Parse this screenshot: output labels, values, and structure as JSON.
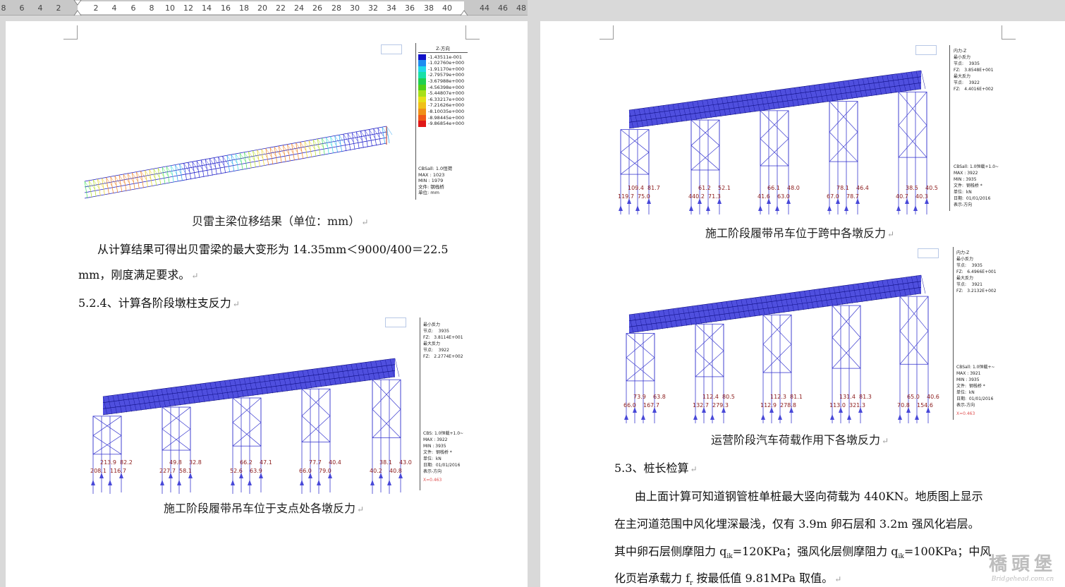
{
  "ruler": {
    "ticks": [
      "8",
      "6",
      "4",
      "2",
      "2",
      "4",
      "6",
      "8",
      "10",
      "12",
      "14",
      "16",
      "18",
      "20",
      "22",
      "24",
      "26",
      "28",
      "30",
      "32",
      "34",
      "36",
      "38",
      "40",
      "44",
      "46",
      "48"
    ]
  },
  "page1": {
    "fig1": {
      "legend_title": "Z-方向",
      "values": [
        "-1.43511e-001",
        "-1.02760e+000",
        "-1.91170e+000",
        "-2.79579e+000",
        "-3.67988e+000",
        "-4.56398e+000",
        "-5.44807e+000",
        "-6.33217e+000",
        "-7.21626e+000",
        "-8.10035e+000",
        "-8.98445e+000",
        "-9.86854e+000"
      ],
      "colors": [
        "#1212c8",
        "#1e8cf0",
        "#20d8e8",
        "#18e0a8",
        "#20d050",
        "#50d018",
        "#a8e018",
        "#e6e018",
        "#f0c018",
        "#f09018",
        "#f05818",
        "#e01818"
      ],
      "info": [
        "CBSall: 1.0恒荷",
        "MAX : 1023",
        "MIN : 1979",
        "文件:  钢栈桥",
        "单位:  mm"
      ],
      "caption": "贝雷主梁位移结果（单位：mm）"
    },
    "paragraph": {
      "line1": "从计算结果可得出贝雷梁的最大变形为 14.35mm＜9000/400＝22.5",
      "line2": "mm，刚度满足要求。"
    },
    "heading": "5.2.4、计算各阶段墩柱支反力",
    "fig2": {
      "panel": [
        "最小反力",
        "节点:    3935",
        "FZ:   3.8114E+001",
        "最大反力",
        "节点:    3922",
        "FZ:   2.2774E+002"
      ],
      "info": [
        "CBS: 1.0恒载+1.0~",
        "MAX : 3922",
        "MIN : 3935",
        "文件:  钢栈桥 *",
        "单位:  kN",
        "日期:  01/01/2016",
        "表示-方向"
      ],
      "labels": [
        "208.1",
        "213.9",
        "116.7",
        "82.2",
        "227.7",
        "49.8",
        "58.1",
        "32.8",
        "52.6",
        "66.2",
        "63.9",
        "47.1",
        "66.0",
        "77.7",
        "79.0",
        "40.4",
        "40.2",
        "38.1",
        "40.8",
        "43.0"
      ],
      "scale": "X=0.463",
      "caption": "施工阶段履带吊车位于支点处各墩反力"
    }
  },
  "page2": {
    "fig3": {
      "panel": [
        "内力-Z",
        "最小反力",
        "节点:    3935",
        "FZ:   3.8548E+001",
        "最大反力",
        "节点:    3922",
        "FZ:   4.4016E+002"
      ],
      "info": [
        "CBSall: 1.0恒载+1.0~",
        "MAX : 3922",
        "MIN : 3935",
        "文件:  钢栈桥 *",
        "单位:  kN",
        "日期:  01/01/2016",
        "表示-方向"
      ],
      "labels": [
        "119.7",
        "109.4",
        "75.0",
        "81.7",
        "440.2",
        "61.2",
        "71.3",
        "52.1",
        "41.6",
        "66.1",
        "63.0",
        "48.0",
        "67.0",
        "78.1",
        "78.7",
        "46.4",
        "40.7",
        "38.5",
        "40.3",
        "40.5"
      ],
      "caption": "施工阶段履带吊车位于跨中各墩反力"
    },
    "fig4": {
      "panel": [
        "内力-Z",
        "最小反力",
        "节点:    3935",
        "FZ:   6.4966E+001",
        "最大反力",
        "节点:    3921",
        "FZ:   3.2132E+002"
      ],
      "info": [
        "CBSall: 1.0恒载+~",
        "MAX : 3921",
        "MIN : 3935",
        "文件:  钢栈桥 *",
        "单位:  kN",
        "日期:  01/01/2016",
        "表示-方向"
      ],
      "labels": [
        "66.0",
        "73.9",
        "167.7",
        "63.8",
        "132.7",
        "112.4",
        "279.3",
        "80.5",
        "112.9",
        "112.3",
        "278.8",
        "81.1",
        "113.0",
        "131.4",
        "321.3",
        "81.3",
        "70.8",
        "65.0",
        "154.6",
        "40.6"
      ],
      "scale": "X=0.463",
      "caption": "运营阶段汽车荷载作用下各墩反力"
    },
    "heading": "5.3、桩长检算",
    "para": {
      "l1": "由上面计算可知道钢管桩单桩最大竖向荷载为 440KN。地质图上显示",
      "l2": "在主河道范围中风化埋深最浅，仅有 3.9m 卵石层和 3.2m 强风化岩层。",
      "l3a": "其中卵石层侧摩阻力 q",
      "l3sub1": "ik",
      "l3b": "=120KPa；强风化层侧摩阻力 q",
      "l3sub2": "ik",
      "l3c": "=100KPa；中风",
      "l4a": "化页岩承载力 f",
      "l4sub": "r",
      "l4b": " 按最低值 9.81MPa 取值。"
    }
  },
  "watermark": {
    "line1": "橋頭堡",
    "line2": "Bridgehead.com.cn"
  }
}
